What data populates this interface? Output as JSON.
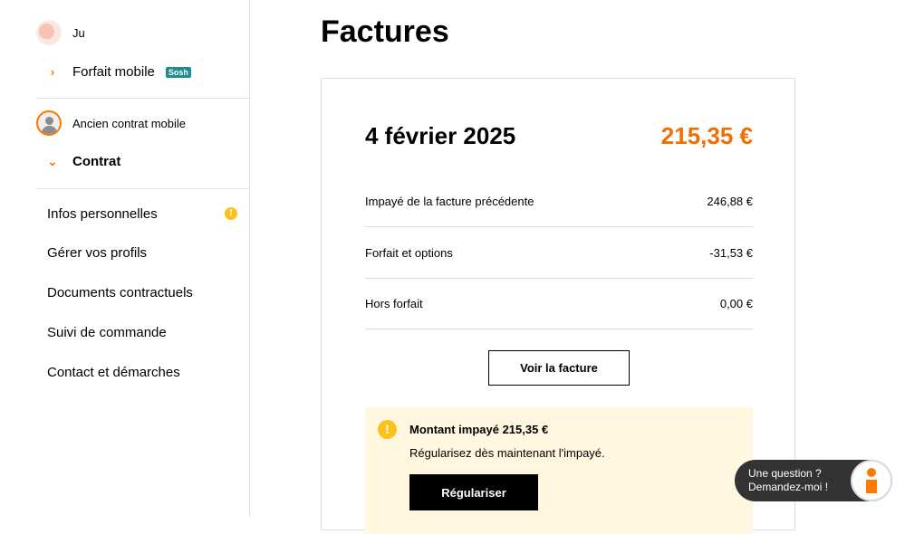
{
  "sidebar": {
    "account1": {
      "name": "Ju   ",
      "service_label": "Forfait mobile",
      "badge": "Sosh"
    },
    "account2": {
      "name": "Ancien contrat mobile",
      "section_label": "Contrat"
    },
    "menu": [
      {
        "label": "Infos personnelles",
        "warning": "!"
      },
      {
        "label": "Gérer vos profils"
      },
      {
        "label": "Documents contractuels"
      },
      {
        "label": "Suivi de commande"
      },
      {
        "label": "Contact et démarches"
      }
    ]
  },
  "main": {
    "title": "Factures",
    "bill": {
      "date": "4 février 2025",
      "total": "215,35 €",
      "total_color": "#f16e00",
      "rows": [
        {
          "label": "Impayé de la facture précédente",
          "value": "246,88 €"
        },
        {
          "label": "Forfait et options",
          "value": "-31,53 €"
        },
        {
          "label": "Hors forfait",
          "value": "0,00 €"
        }
      ],
      "view_button": "Voir la facture"
    },
    "alert": {
      "icon": "!",
      "title": "Montant impayé 215,35 €",
      "text": "Régularisez dès maintenant l'impayé.",
      "button": "Régulariser"
    }
  },
  "chat": {
    "line1": "Une question ?",
    "line2": "Demandez-moi !"
  }
}
